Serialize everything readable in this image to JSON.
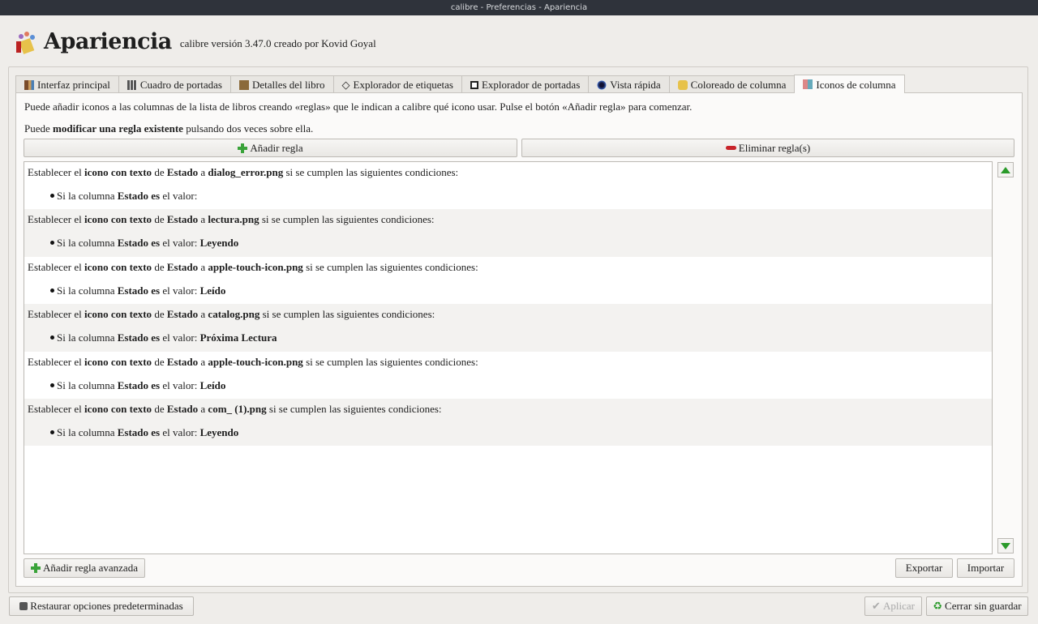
{
  "window_title": "calibre - Preferencias - Apariencia",
  "header": {
    "title": "Apariencia",
    "version": "calibre versión 3.47.0 creado por Kovid Goyal"
  },
  "tabs": [
    {
      "label": "Interfaz principal",
      "icon": "books-icon"
    },
    {
      "label": "Cuadro de portadas",
      "icon": "grid-icon"
    },
    {
      "label": "Detalles del libro",
      "icon": "book-icon"
    },
    {
      "label": "Explorador de etiquetas",
      "icon": "tag-icon"
    },
    {
      "label": "Explorador de portadas",
      "icon": "cover-icon"
    },
    {
      "label": "Vista rápida",
      "icon": "eye-icon"
    },
    {
      "label": "Coloreado de columna",
      "icon": "palette-icon"
    },
    {
      "label": "Iconos de columna",
      "icon": "column-icons-icon",
      "active": true
    }
  ],
  "intro": {
    "line1": "Puede añadir iconos a las columnas de la lista de libros creando «reglas» que le indican a calibre qué icono usar. Pulse el botón «Añadir regla» para comenzar.",
    "line2_pre": "Puede ",
    "line2_bold": "modificar una regla existente",
    "line2_post": " pulsando dos veces sobre ella."
  },
  "buttons": {
    "add_rule": "Añadir regla",
    "remove_rules": "Eliminar regla(s)",
    "add_advanced": "Añadir regla avanzada",
    "export": "Exportar",
    "import": "Importar",
    "restore": "Restaurar opciones predeterminadas",
    "apply": "Aplicar",
    "close": "Cerrar sin guardar"
  },
  "rule_text": {
    "a": "Establecer el ",
    "b": "icono con texto",
    "c": " de ",
    "d": "Estado",
    "e": " a ",
    "f": " si se cumplen las siguientes condiciones:",
    "g": "Si la columna ",
    "h": "Estado es",
    "i": " el valor: "
  },
  "rules": [
    {
      "icon": "dialog_error.png",
      "value": ""
    },
    {
      "icon": "lectura.png",
      "value": "Leyendo"
    },
    {
      "icon": "apple-touch-icon.png",
      "value": "Leído"
    },
    {
      "icon": "catalog.png",
      "value": "Próxima Lectura"
    },
    {
      "icon": "apple-touch-icon.png",
      "value": "Leído"
    },
    {
      "icon": "com_ (1).png",
      "value": "Leyendo"
    }
  ]
}
